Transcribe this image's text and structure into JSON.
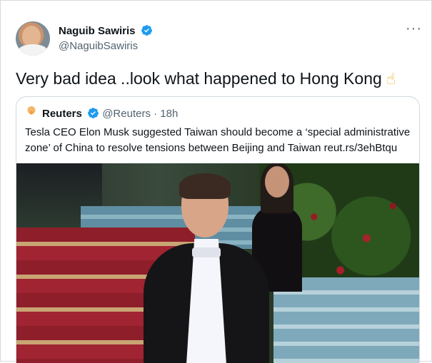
{
  "author": {
    "name": "Naguib Sawiris",
    "handle": "@NaguibSawiris",
    "verified_icon": "verified-badge-icon"
  },
  "more_label": "···",
  "tweet": {
    "text": "Very bad idea ..look what happened to Hong Kong",
    "emoji": "☝"
  },
  "quoted": {
    "name": "Reuters",
    "handle": "@Reuters",
    "dot": "·",
    "time": "18h",
    "text": "Tesla CEO Elon Musk suggested Taiwan should become a ‘special administrative zone’ of China to resolve tensions between Beijing and Taiwan",
    "link": "reut.rs/3ehBtqu"
  },
  "colors": {
    "verified_blue": "#1d9bf0",
    "secondary_text": "#536471",
    "border": "#cfd9de"
  }
}
